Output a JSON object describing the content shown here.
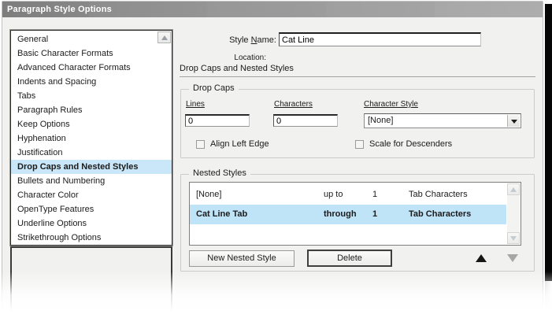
{
  "window": {
    "title": "Paragraph Style Options"
  },
  "sidebar": {
    "items": [
      {
        "label": "General"
      },
      {
        "label": "Basic Character Formats"
      },
      {
        "label": "Advanced Character Formats"
      },
      {
        "label": "Indents and Spacing"
      },
      {
        "label": "Tabs"
      },
      {
        "label": "Paragraph Rules"
      },
      {
        "label": "Keep Options"
      },
      {
        "label": "Hyphenation"
      },
      {
        "label": "Justification"
      },
      {
        "label": "Drop Caps and Nested Styles"
      },
      {
        "label": "Bullets and Numbering"
      },
      {
        "label": "Character Color"
      },
      {
        "label": "OpenType Features"
      },
      {
        "label": "Underline Options"
      },
      {
        "label": "Strikethrough Options"
      }
    ],
    "selected_item": "Drop Caps and Nested Styles"
  },
  "style_name": {
    "label_prefix": "Style ",
    "label_mnemonic": "N",
    "label_suffix": "ame:",
    "value": "Cat Line",
    "location_label": "Location:"
  },
  "section": {
    "heading": "Drop Caps and Nested Styles"
  },
  "drop_caps": {
    "legend": "Drop Caps",
    "lines_label": "Lines",
    "lines_value": "0",
    "characters_label": "Characters",
    "characters_value": "0",
    "character_style_label": "Character Style",
    "character_style_value": "[None]",
    "align_left_edge_label": "Align Left Edge",
    "align_left_edge_checked": false,
    "scale_for_descenders_label": "Scale for Descenders",
    "scale_for_descenders_checked": false
  },
  "nested_styles": {
    "legend": "Nested Styles",
    "rows": [
      {
        "name": "[None]",
        "match": "up to",
        "count": "1",
        "unit": "Tab Characters",
        "selected": false
      },
      {
        "name": "Cat Line Tab",
        "match": "through",
        "count": "1",
        "unit": "Tab Characters",
        "selected": true
      }
    ],
    "new_button": "New Nested Style",
    "delete_button": "Delete"
  },
  "colors": {
    "sidebar_selection": "#c9e7f8",
    "row_selection": "#bfe3f7",
    "titlebar_gray_start": "#7d7d7d",
    "titlebar_gray_end": "#adadad",
    "dialog_background": "#f1f1f0",
    "backdrop_black": "#070707"
  }
}
